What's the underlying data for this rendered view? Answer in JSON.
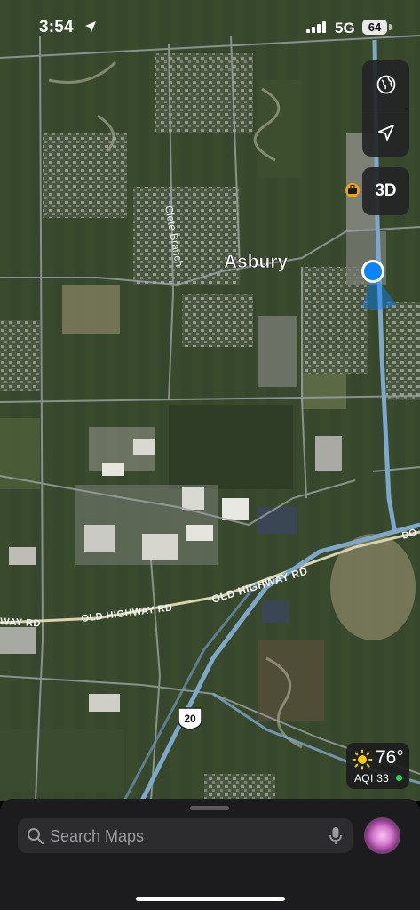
{
  "status_bar": {
    "time": "3:54",
    "network": "5G",
    "battery": "64"
  },
  "map": {
    "place_label": "Asbury",
    "streets": {
      "clete_branch": "Clete Branch",
      "old_highway_main": "OLD HIGHWAY RD",
      "old_highway_mid": "OLD HIGHWAY RD",
      "old_highway_left": "WAY RD",
      "dodge_partial": "DO"
    },
    "route_shield": "20",
    "controls": {
      "three_d": "3D"
    }
  },
  "weather": {
    "temperature": "76°",
    "aqi": "AQI 33"
  },
  "search": {
    "placeholder": "Search Maps"
  },
  "colors": {
    "user_dot": "#0a84ff",
    "aqi_good": "#30d158",
    "sheet_bg": "#1c1c1e"
  },
  "icons": [
    "location-arrow-icon",
    "signal-icon",
    "globe-icon",
    "navigation-arrow-icon",
    "suitcase-icon",
    "sun-icon",
    "search-icon",
    "microphone-icon"
  ]
}
